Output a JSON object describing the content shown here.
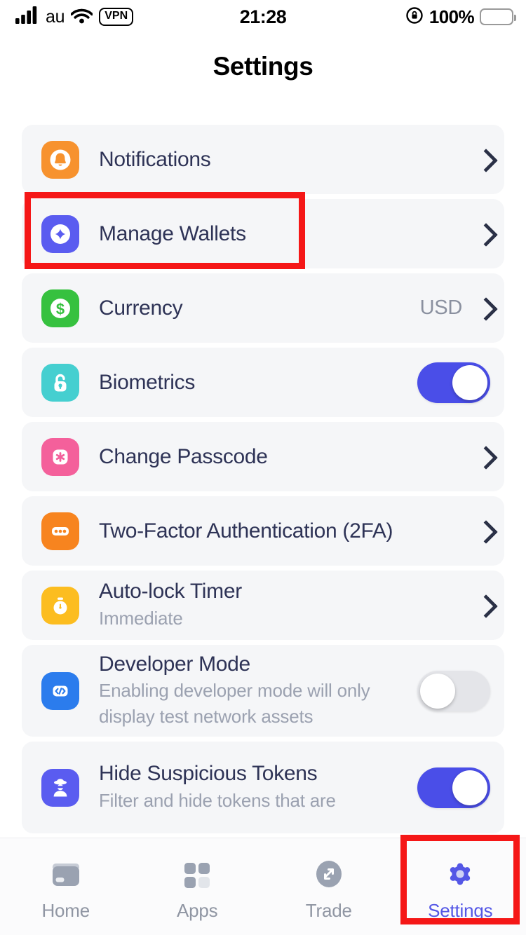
{
  "status_bar": {
    "carrier": "au",
    "vpn_badge": "VPN",
    "time": "21:28",
    "battery_percent": "100%",
    "signal_icon": "cellular-signal-icon",
    "wifi_icon": "wifi-icon",
    "lock_rotation_icon": "rotation-lock-icon",
    "battery_icon": "battery-full-icon"
  },
  "header": {
    "title": "Settings"
  },
  "colors": {
    "accent": "#4a4ee8",
    "title_text": "#2e3356",
    "subtitle_text": "#9ba1b0",
    "card_bg": "#f5f6f8",
    "annotation": "#f51717",
    "notifications_icon": "#f7922e",
    "wallets_icon": "#5a5cf0",
    "currency_icon": "#36c13f",
    "biometrics_icon": "#45cfd0",
    "passcode_icon": "#f4609b",
    "twofa_icon": "#f7841f",
    "autolock_icon": "#fcbd20",
    "developer_icon": "#2b7ced",
    "suspicious_icon": "#5a5cf0"
  },
  "settings_rows": [
    {
      "id": "notifications",
      "icon": "bell-icon",
      "title": "Notifications",
      "subtitle": "",
      "value": "",
      "control": "chevron"
    },
    {
      "id": "manage-wallets",
      "icon": "wallet-diamond-icon",
      "title": "Manage Wallets",
      "subtitle": "",
      "value": "",
      "control": "chevron",
      "highlighted": true
    },
    {
      "id": "currency",
      "icon": "dollar-icon",
      "title": "Currency",
      "subtitle": "",
      "value": "USD",
      "control": "chevron"
    },
    {
      "id": "biometrics",
      "icon": "lock-icon",
      "title": "Biometrics",
      "subtitle": "",
      "value": "",
      "control": "toggle",
      "toggle_state": "on"
    },
    {
      "id": "change-passcode",
      "icon": "asterisk-icon",
      "title": "Change Passcode",
      "subtitle": "",
      "value": "",
      "control": "chevron"
    },
    {
      "id": "two-factor-authentication",
      "icon": "dots-icon",
      "title": "Two-Factor Authentication (2FA)",
      "subtitle": "",
      "value": "",
      "control": "chevron"
    },
    {
      "id": "auto-lock-timer",
      "icon": "stopwatch-icon",
      "title": "Auto-lock Timer",
      "subtitle": "Immediate",
      "value": "",
      "control": "chevron"
    },
    {
      "id": "developer-mode",
      "icon": "code-brackets-icon",
      "title": "Developer Mode",
      "subtitle": "Enabling developer mode will only display test network assets",
      "value": "",
      "control": "toggle",
      "toggle_state": "off"
    },
    {
      "id": "hide-suspicious-tokens",
      "icon": "spy-icon",
      "title": "Hide Suspicious Tokens",
      "subtitle": "Filter and hide tokens that are",
      "value": "",
      "control": "toggle",
      "toggle_state": "on"
    }
  ],
  "tab_bar": {
    "tabs": [
      {
        "id": "home",
        "label": "Home",
        "icon": "wallet-icon",
        "active": false
      },
      {
        "id": "apps",
        "label": "Apps",
        "icon": "grid-icon",
        "active": false
      },
      {
        "id": "trade",
        "label": "Trade",
        "icon": "expand-arrows-icon",
        "active": false
      },
      {
        "id": "settings",
        "label": "Settings",
        "icon": "gear-icon",
        "active": true
      }
    ]
  },
  "annotations": [
    {
      "id": "manage-wallets-highlight",
      "target": "Manage Wallets row"
    },
    {
      "id": "settings-tab-highlight",
      "target": "Settings tab"
    }
  ]
}
